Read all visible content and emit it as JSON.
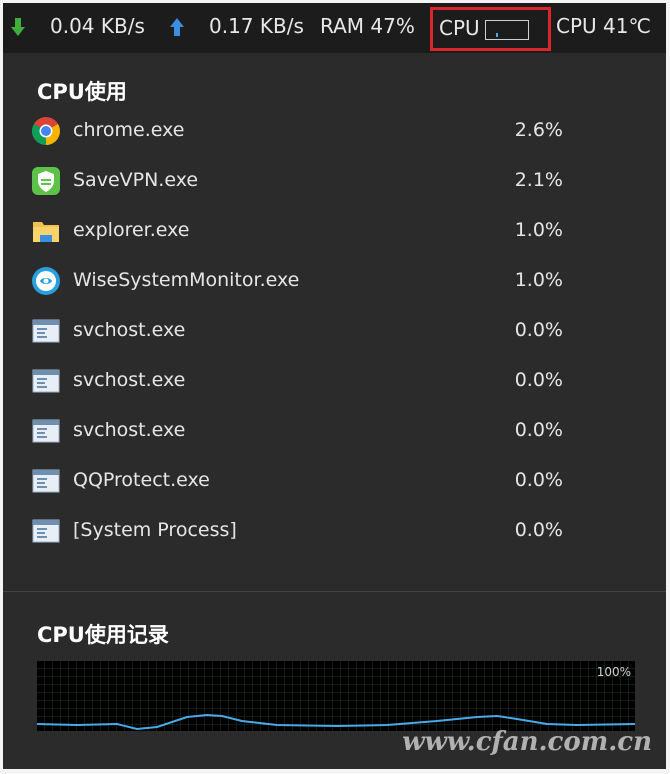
{
  "topbar": {
    "download_speed": "0.04 KB/s",
    "upload_speed": "0.17 KB/s",
    "ram": "RAM 47%",
    "cpu_label": "CPU",
    "cpu_temp": "CPU 41℃",
    "colors": {
      "download_arrow": "#3fae3a",
      "upload_arrow": "#3a8fe0",
      "highlight_box": "#d8262a"
    }
  },
  "cpu_usage": {
    "title": "CPU使用",
    "processes": [
      {
        "name": "chrome.exe",
        "percent": "2.6%",
        "icon": "chrome-icon"
      },
      {
        "name": "SaveVPN.exe",
        "percent": "2.1%",
        "icon": "savevpn-icon"
      },
      {
        "name": "explorer.exe",
        "percent": "1.0%",
        "icon": "folder-icon"
      },
      {
        "name": "WiseSystemMonitor.exe",
        "percent": "1.0%",
        "icon": "wise-monitor-icon"
      },
      {
        "name": "svchost.exe",
        "percent": "0.0%",
        "icon": "window-app-icon"
      },
      {
        "name": "svchost.exe",
        "percent": "0.0%",
        "icon": "window-app-icon"
      },
      {
        "name": "svchost.exe",
        "percent": "0.0%",
        "icon": "window-app-icon"
      },
      {
        "name": "QQProtect.exe",
        "percent": "0.0%",
        "icon": "window-app-icon"
      },
      {
        "name": "[System Process]",
        "percent": "0.0%",
        "icon": "window-app-icon"
      }
    ]
  },
  "cpu_history": {
    "title": "CPU使用记录",
    "max_label": "100%",
    "line_color": "#4aa9e8"
  },
  "watermark": "www.cfan.com.cn"
}
